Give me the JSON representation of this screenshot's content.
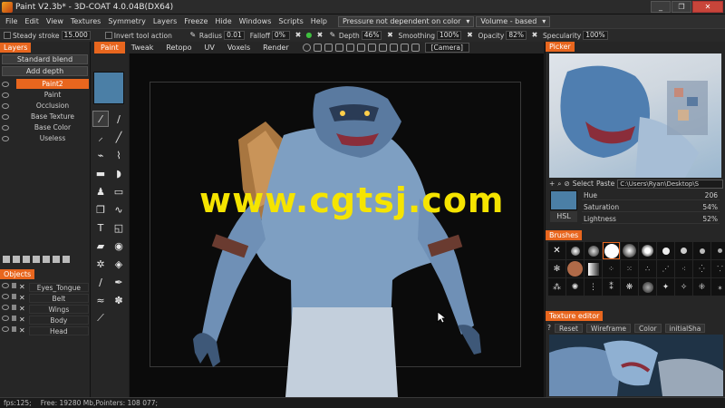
{
  "window": {
    "title": "Paint V2.3b* - 3D-COAT 4.0.04B(DX64)",
    "controls": [
      "_",
      "❐",
      "✕"
    ]
  },
  "menu": {
    "items": [
      "File",
      "Edit",
      "View",
      "Textures",
      "Symmetry",
      "Layers",
      "Freeze",
      "Hide",
      "Windows",
      "Scripts",
      "Help"
    ],
    "pressure_select": "Pressure not dependent on color",
    "volume_select": "Volume - based"
  },
  "toolbar": {
    "steady_stroke_label": "Steady stroke",
    "steady_stroke_value": "15.000",
    "invert_label": "Invert tool action",
    "radius_label": "Radius",
    "radius_value": "0.01",
    "falloff_label": "Falloff",
    "falloff_value": "0%",
    "depth_label": "Depth",
    "depth_value": "46%",
    "smoothing_label": "Smoothing",
    "smoothing_value": "100%",
    "opacity_label": "Opacity",
    "opacity_value": "82%",
    "specularity_label": "Specularity",
    "specularity_value": "100%"
  },
  "layers_panel": {
    "tab": "Layers",
    "blend_mode": "Standard blend",
    "add_depth": "Add depth",
    "items": [
      "Paint2",
      "Paint",
      "Occlusion",
      "Base Texture",
      "Base Color",
      "Useless"
    ],
    "selected": "Paint2"
  },
  "objects_panel": {
    "tab": "Objects",
    "items": [
      "Eyes_Tongue",
      "Belt",
      "Wings",
      "Body",
      "Head"
    ]
  },
  "rooms": {
    "tabs": [
      "Paint",
      "Tweak",
      "Retopo",
      "UV",
      "Voxels",
      "Render"
    ],
    "active": "Paint",
    "camera": "[Camera]"
  },
  "viewport": {
    "watermark": "www.cgtsj.com"
  },
  "picker": {
    "tab": "Picker",
    "select_label": "Select",
    "paste_label": "Paste",
    "path": "C:\\Users\\Ryan\\Desktop\\S",
    "mode": "HSL",
    "hue_label": "Hue",
    "hue_value": "206",
    "saturation_label": "Saturation",
    "saturation_value": "54%",
    "lightness_label": "Lightness",
    "lightness_value": "52%",
    "swatch_color": "#4b7fa6"
  },
  "brushes": {
    "tab": "Brushes"
  },
  "texture_editor": {
    "tab": "Texture editor",
    "reset": "Reset",
    "wireframe": "Wireframe",
    "color": "Color",
    "initial": "initialSha"
  },
  "status": {
    "fps": "fps:125;",
    "free": "Free: 19280 Mb,Pointers: 108 077;"
  },
  "colors": {
    "accent": "#e8661e",
    "watermark": "#f5e400"
  }
}
